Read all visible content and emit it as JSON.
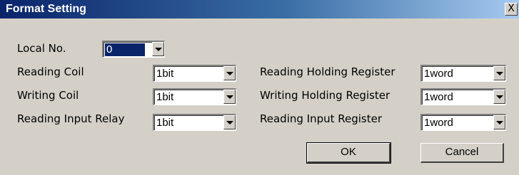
{
  "window": {
    "title": "Format Setting",
    "close_glyph": "X"
  },
  "local_no": {
    "label": "Local No.",
    "value": "0"
  },
  "left_fields": [
    {
      "label": "Reading Coil",
      "value": "1bit"
    },
    {
      "label": "Writing Coil",
      "value": "1bit"
    },
    {
      "label": "Reading Input Relay",
      "value": "1bit"
    }
  ],
  "right_fields": [
    {
      "label": "Reading Holding Register",
      "value": "1word"
    },
    {
      "label": "Writing Holding Register",
      "value": "1word"
    },
    {
      "label": "Reading Input Register",
      "value": "1word"
    }
  ],
  "buttons": {
    "ok": "OK",
    "cancel": "Cancel"
  },
  "colors": {
    "title_bar_start": "#0a246a",
    "title_bar_end": "#a6caf0",
    "dialog_face": "#d4d0c8",
    "selection": "#0a246a"
  }
}
